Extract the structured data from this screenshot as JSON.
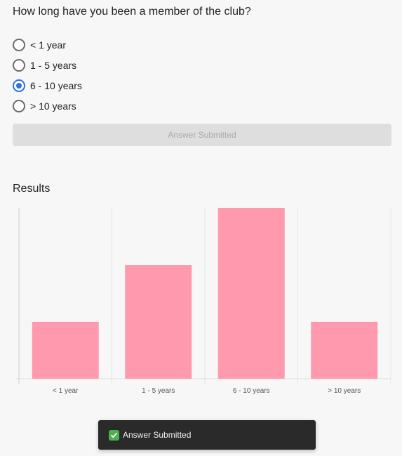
{
  "question": {
    "text": "How long have you been a member of the club?"
  },
  "options": [
    {
      "label": "< 1 year",
      "checked": false
    },
    {
      "label": "1 - 5 years",
      "checked": false
    },
    {
      "label": "6 - 10 years",
      "checked": true
    },
    {
      "label": "> 10 years",
      "checked": false
    }
  ],
  "submit": {
    "label": "Answer Submitted"
  },
  "results": {
    "title": "Results"
  },
  "toast": {
    "text": "Answer Submitted",
    "icon": "check-icon"
  },
  "colors": {
    "bar": "#ff99ad",
    "radio_selected": "#2f6fe4",
    "toast_bg": "#2a2a2a",
    "toast_icon": "#4caf50"
  },
  "chart_data": {
    "type": "bar",
    "categories": [
      "< 1 year",
      "1 - 5 years",
      "6 - 10 years",
      "> 10 years"
    ],
    "values": [
      1,
      2,
      3,
      1
    ],
    "ylim": [
      0,
      3
    ],
    "grid": true
  }
}
